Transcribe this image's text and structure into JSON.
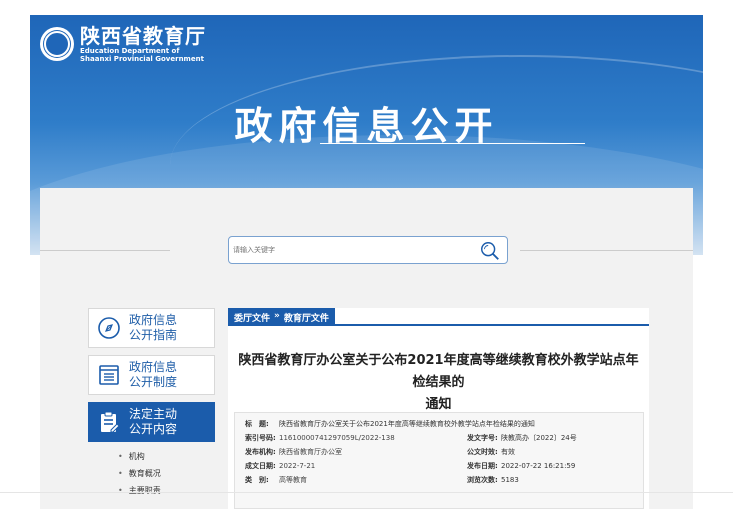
{
  "header": {
    "logo_cn": "陕西省教育厅",
    "logo_en_line1": "Education Department of",
    "logo_en_line2": "Shaanxi Provincial Government",
    "page_title": "政府信息公开"
  },
  "search": {
    "placeholder": "请输入关键字"
  },
  "sidebar": {
    "items": [
      {
        "line1": "政府信息",
        "line2": "公开指南",
        "icon": "compass-icon"
      },
      {
        "line1": "政府信息",
        "line2": "公开制度",
        "icon": "document-list-icon"
      },
      {
        "line1": "法定主动",
        "line2": "公开内容",
        "icon": "clipboard-edit-icon"
      }
    ],
    "sub_items": [
      "机构",
      "教育概况",
      "主要职责"
    ]
  },
  "main": {
    "breadcrumb": [
      "委厅文件",
      "»",
      "教育厅文件"
    ],
    "doc_title_line1": "陕西省教育厅办公室关于公布2021年度高等继续教育校外教学站点年检结果的",
    "doc_title_line2": "通知",
    "meta": {
      "title_k": "标　题:",
      "title_v": "陕西省教育厅办公室关于公布2021年度高等继续教育校外教学站点年检结果的通知",
      "index_k": "索引号码:",
      "index_v": "11610000741297059L/2022-138",
      "docno_k": "发文字号:",
      "docno_v": "陕教高办〔2022〕24号",
      "org_k": "发布机构:",
      "org_v": "陕西省教育厅办公室",
      "valid_k": "公文时效:",
      "valid_v": "有效",
      "date_k": "成文日期:",
      "date_v": "2022-7-21",
      "pub_k": "发布日期:",
      "pub_v": "2022-07-22 16:21:59",
      "cat_k": "类　别:",
      "cat_v": "高等教育",
      "views_k": "浏览次数:",
      "views_v": "5183"
    }
  },
  "colors": {
    "brand_blue": "#1b5cab",
    "banner_blue": "#1f66b8",
    "content_bg": "#f2f2f2"
  }
}
